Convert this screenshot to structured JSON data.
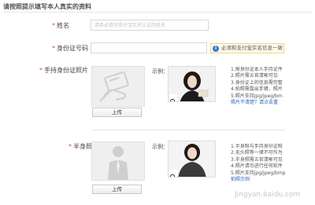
{
  "page": {
    "title": "请按照提示填写本人真实的资料"
  },
  "form": {
    "name": {
      "label": "姓名",
      "placeholder": "请务必填写支付宝实名认证的姓名"
    },
    "id_number": {
      "label": "身份证号码",
      "tip": "必须和支付宝实名信息一致"
    },
    "id_photo": {
      "label": "手持身份证照片",
      "upload_button": "上传",
      "example_label": "示例：",
      "notes": [
        "1.需身份证本人手持证件",
        "2.照片需五官清晰可见",
        "3.身份证上的信息需完整",
        "4.拍照需露出手臂，照片",
        "5.照片支持jpg/jpeg/bm"
      ],
      "link": "照片不清楚？请点击重"
    },
    "half_body": {
      "label": "半身照",
      "upload_button": "上传",
      "example_label": "示例：",
      "notes": [
        "1.半身照与手持身份证照",
        "2.无头照等一律不可作为",
        "3.半身照需五官清晰可见",
        "4.照片请勿进行任何软件",
        "5.照片支持jpg/jpeg/bmp"
      ],
      "link": "拍照示例"
    }
  },
  "watermark": "Jingyan.baidu.com",
  "colors": {
    "required": "#e64a3b",
    "tip_icon": "#2f7bd8",
    "link": "#2a63b8"
  },
  "icons": {
    "tip": "info-icon",
    "zoom": "magnifier-icon",
    "id_placeholder": "hand-holding-card-icon",
    "body_placeholder": "person-silhouette-icon"
  }
}
